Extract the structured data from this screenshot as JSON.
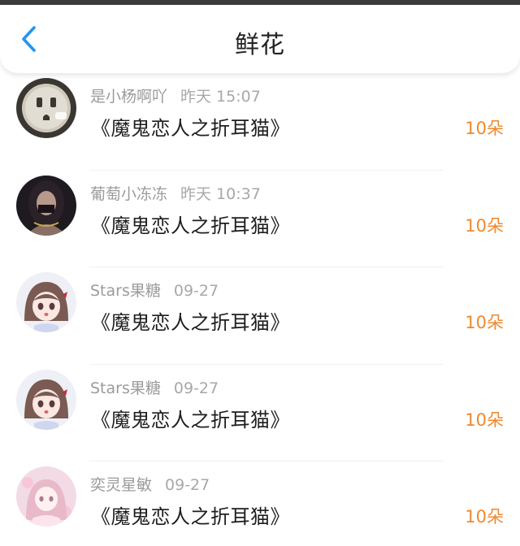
{
  "header": {
    "title": "鲜花",
    "back_icon": "chevron-left-icon",
    "accent": "#2196f3"
  },
  "rows": [
    {
      "name": "是小杨啊吖",
      "time": "昨天 15:07",
      "title": "《魔鬼恋人之折耳猫》",
      "count": "10朵",
      "avatar": "outlet-photo"
    },
    {
      "name": "葡萄小冻冻",
      "time": "昨天 10:37",
      "title": "《魔鬼恋人之折耳猫》",
      "count": "10朵",
      "avatar": "dark-girl-photo"
    },
    {
      "name": "Stars果糖",
      "time": "09-27",
      "title": "《魔鬼恋人之折耳猫》",
      "count": "10朵",
      "avatar": "anime-girl"
    },
    {
      "name": "Stars果糖",
      "time": "09-27",
      "title": "《魔鬼恋人之折耳猫》",
      "count": "10朵",
      "avatar": "anime-girl"
    },
    {
      "name": "奕灵星敏",
      "time": "09-27",
      "title": "《魔鬼恋人之折耳猫》",
      "count": "10朵",
      "avatar": "pink-anime-girl"
    }
  ],
  "colors": {
    "count": "#f0882c",
    "name": "#9b9b9b",
    "title": "#1e1e1e"
  }
}
